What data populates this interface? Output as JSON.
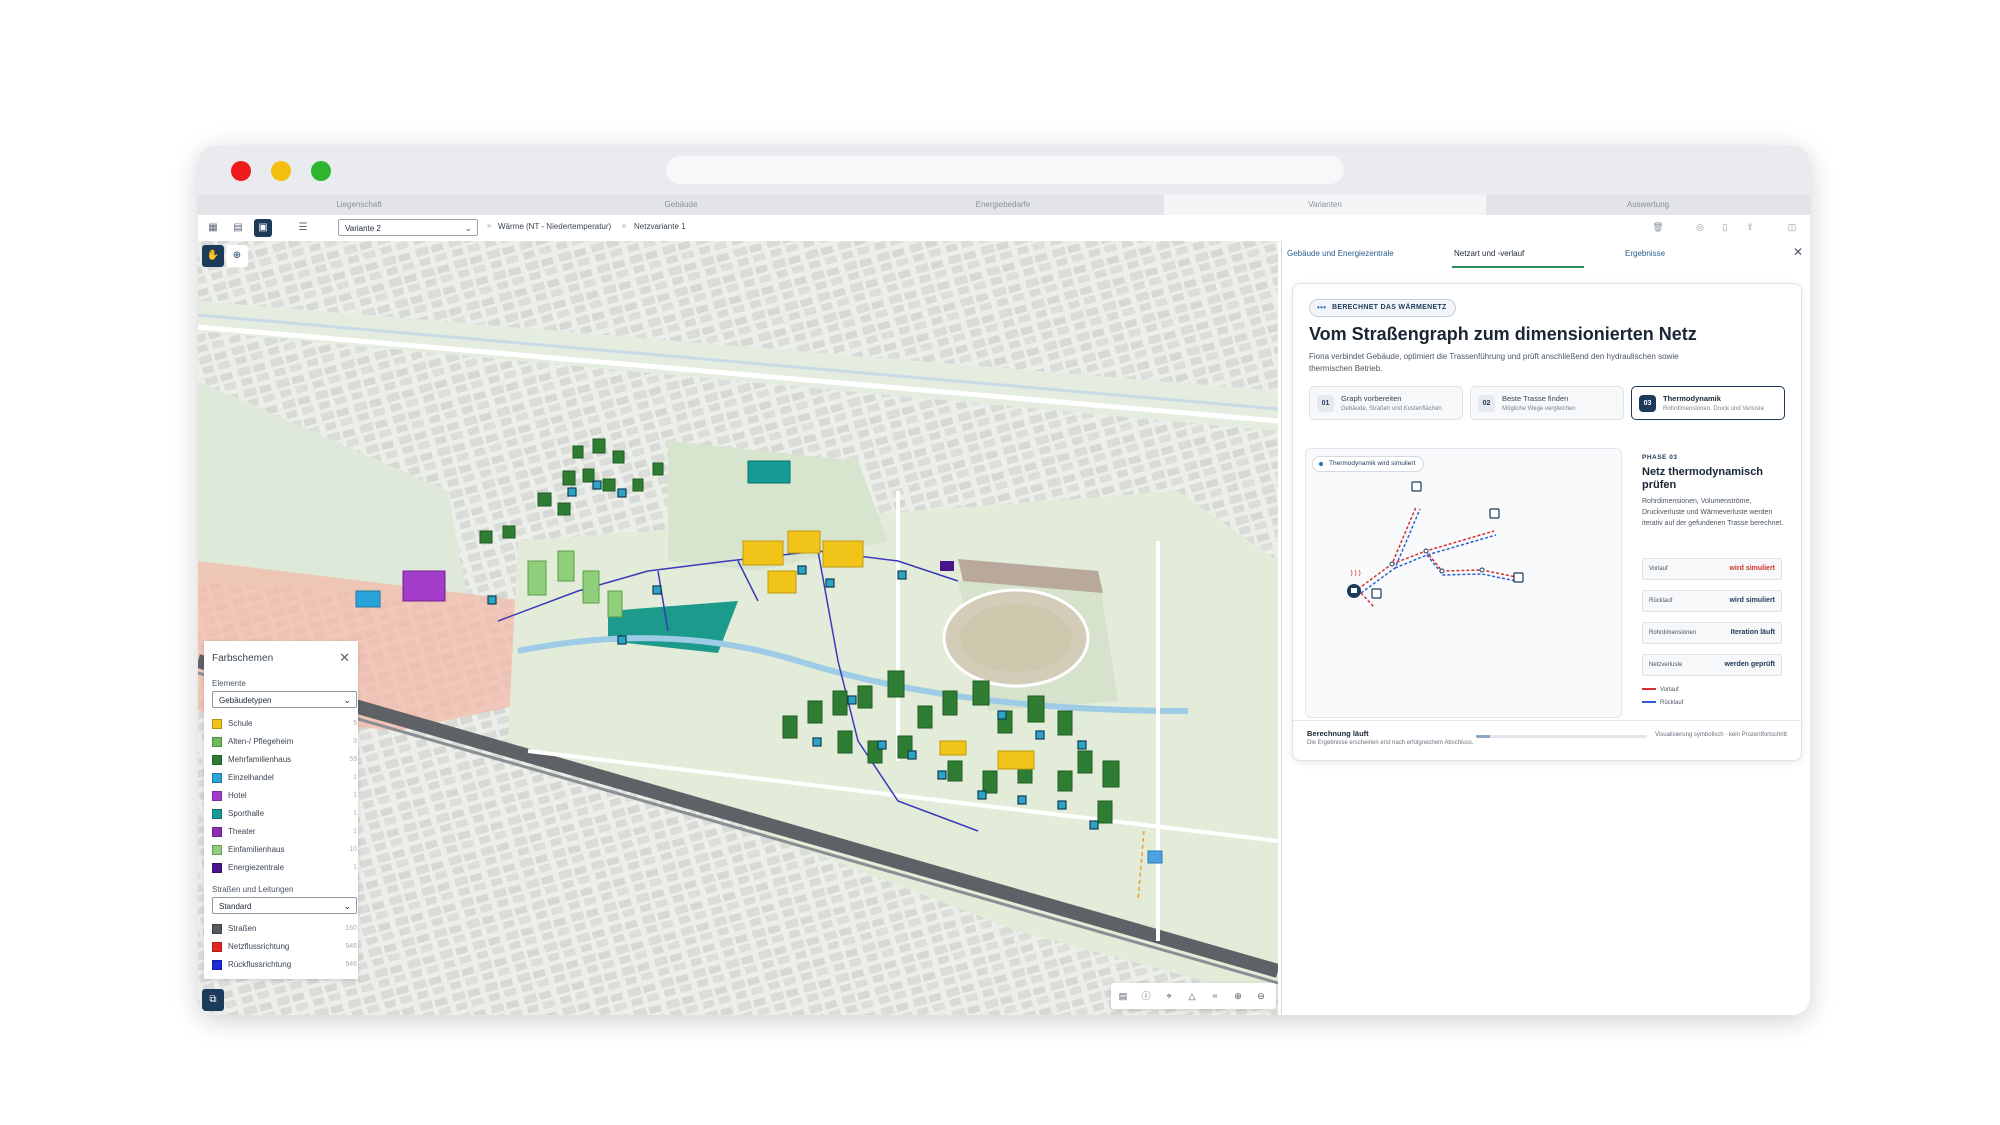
{
  "tabs": [
    "Liegenschaft",
    "Gebäude",
    "Energiebedarfe",
    "Varianten",
    "Auswertung"
  ],
  "active_tab": 3,
  "toolbar": {
    "variant_select": "Variante 2",
    "breadcrumb": [
      "Wärme (NT - Niedertemperatur)",
      "Netzvariante 1"
    ]
  },
  "map": {
    "legend": {
      "title": "Farbschemen",
      "elements_label": "Elemente",
      "elements_select": "Gebäudetypen",
      "items": [
        {
          "name": "Schule",
          "count": "5",
          "color": "#f0c419"
        },
        {
          "name": "Alten-/ Pflegeheim",
          "count": "3",
          "color": "#6dbb5a"
        },
        {
          "name": "Mehrfamilienhaus",
          "count": "59",
          "color": "#2e7d32"
        },
        {
          "name": "Einzelhandel",
          "count": "1",
          "color": "#29a3d9"
        },
        {
          "name": "Hotel",
          "count": "1",
          "color": "#a33cc9"
        },
        {
          "name": "Sporthalle",
          "count": "1",
          "color": "#159a94"
        },
        {
          "name": "Theater",
          "count": "1",
          "color": "#8e2fb3"
        },
        {
          "name": "Einfamilienhaus",
          "count": "10",
          "color": "#8fce7a"
        },
        {
          "name": "Energiezentrale",
          "count": "1",
          "color": "#4a148c"
        }
      ],
      "streets_label": "Straßen und Leitungen",
      "streets_select": "Standard",
      "street_items": [
        {
          "name": "Straßen",
          "count": "160",
          "color": "#555a60"
        },
        {
          "name": "Netzflussrichtung",
          "count": "946",
          "color": "#e52420"
        },
        {
          "name": "Rückflussrichtung",
          "count": "946",
          "color": "#1e2ad8"
        }
      ]
    }
  },
  "panel": {
    "tabs": [
      "Gebäude und Energiezentrale",
      "Netzart und -verlauf",
      "Ergebnisse"
    ],
    "active_tab": 1,
    "badge": "BERECHNET DAS WÄRMENETZ",
    "title": "Vom Straßengraph zum dimensionierten Netz",
    "description": "Fiona verbindet Gebäude, optimiert die Trassenführung und prüft anschließend den hydraulischen sowie thermischen Betrieb.",
    "steps": [
      {
        "num": "01",
        "title": "Graph vorbereiten",
        "sub": "Gebäude, Straßen und Kostenflächen"
      },
      {
        "num": "02",
        "title": "Beste Trasse finden",
        "sub": "Mögliche Wege vergleichen"
      },
      {
        "num": "03",
        "title": "Thermodynamik",
        "sub": "Rohrdimensionen, Druck und Verluste"
      }
    ],
    "viz_badge": "Thermodynamik wird simuliert",
    "phase_label": "PHASE 03",
    "phase_title": "Netz thermodynamisch prüfen",
    "phase_desc": "Rohrdimensionen, Volumenströme, Druckverluste und Wärmeverluste werden iterativ auf der gefundenen Trasse berechnet.",
    "stats": [
      {
        "k": "Vorlauf",
        "v": "wird simuliert"
      },
      {
        "k": "Rücklauf",
        "v": "wird simuliert"
      },
      {
        "k": "Rohrdimensionen",
        "v": "Iteration läuft"
      },
      {
        "k": "Netzverluste",
        "v": "werden geprüft"
      }
    ],
    "legend": [
      "Vorlauf",
      "Rücklauf"
    ],
    "calc_title": "Berechnung läuft",
    "calc_sub": "Die Ergebnisse erscheinen erst nach erfolgreichem Abschluss.",
    "calc_progress": 0.08,
    "calc_note": "Visualisierung symbolisch · kein Prozentfortschritt"
  },
  "colors": {
    "accent": "#1c3a5a",
    "green": "#2a8a5a",
    "vorlauf": "#d42f2f",
    "ruecklauf": "#2c5fd4"
  }
}
